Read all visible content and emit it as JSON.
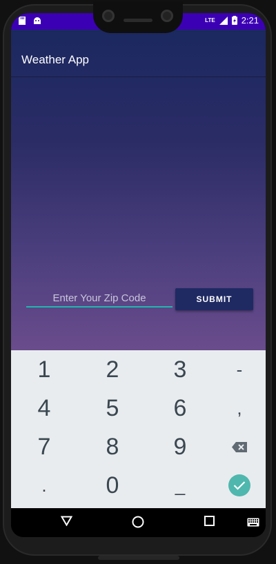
{
  "status_bar": {
    "time": "2:21",
    "network": "LTE",
    "icons": [
      "sd-card-icon",
      "android-icon",
      "signal-icon",
      "battery-charging-icon"
    ],
    "color": "#3c00b4"
  },
  "app": {
    "title": "Weather App",
    "zip_placeholder": "Enter Your Zip Code",
    "zip_value": "",
    "submit_label": "SUBMIT",
    "accent": "#1fb7b0",
    "button_color": "#1f2a63"
  },
  "keyboard": {
    "keys": [
      "1",
      "2",
      "3",
      "-",
      "4",
      "5",
      "6",
      ",",
      "7",
      "8",
      "9",
      ".",
      "0",
      "_"
    ],
    "backspace_icon": "backspace-icon",
    "done_icon": "check-icon",
    "done_color": "#4fb7ae"
  },
  "nav_bar": {
    "buttons": [
      "back-icon",
      "home-icon",
      "recents-icon",
      "keyboard-switch-icon"
    ]
  }
}
